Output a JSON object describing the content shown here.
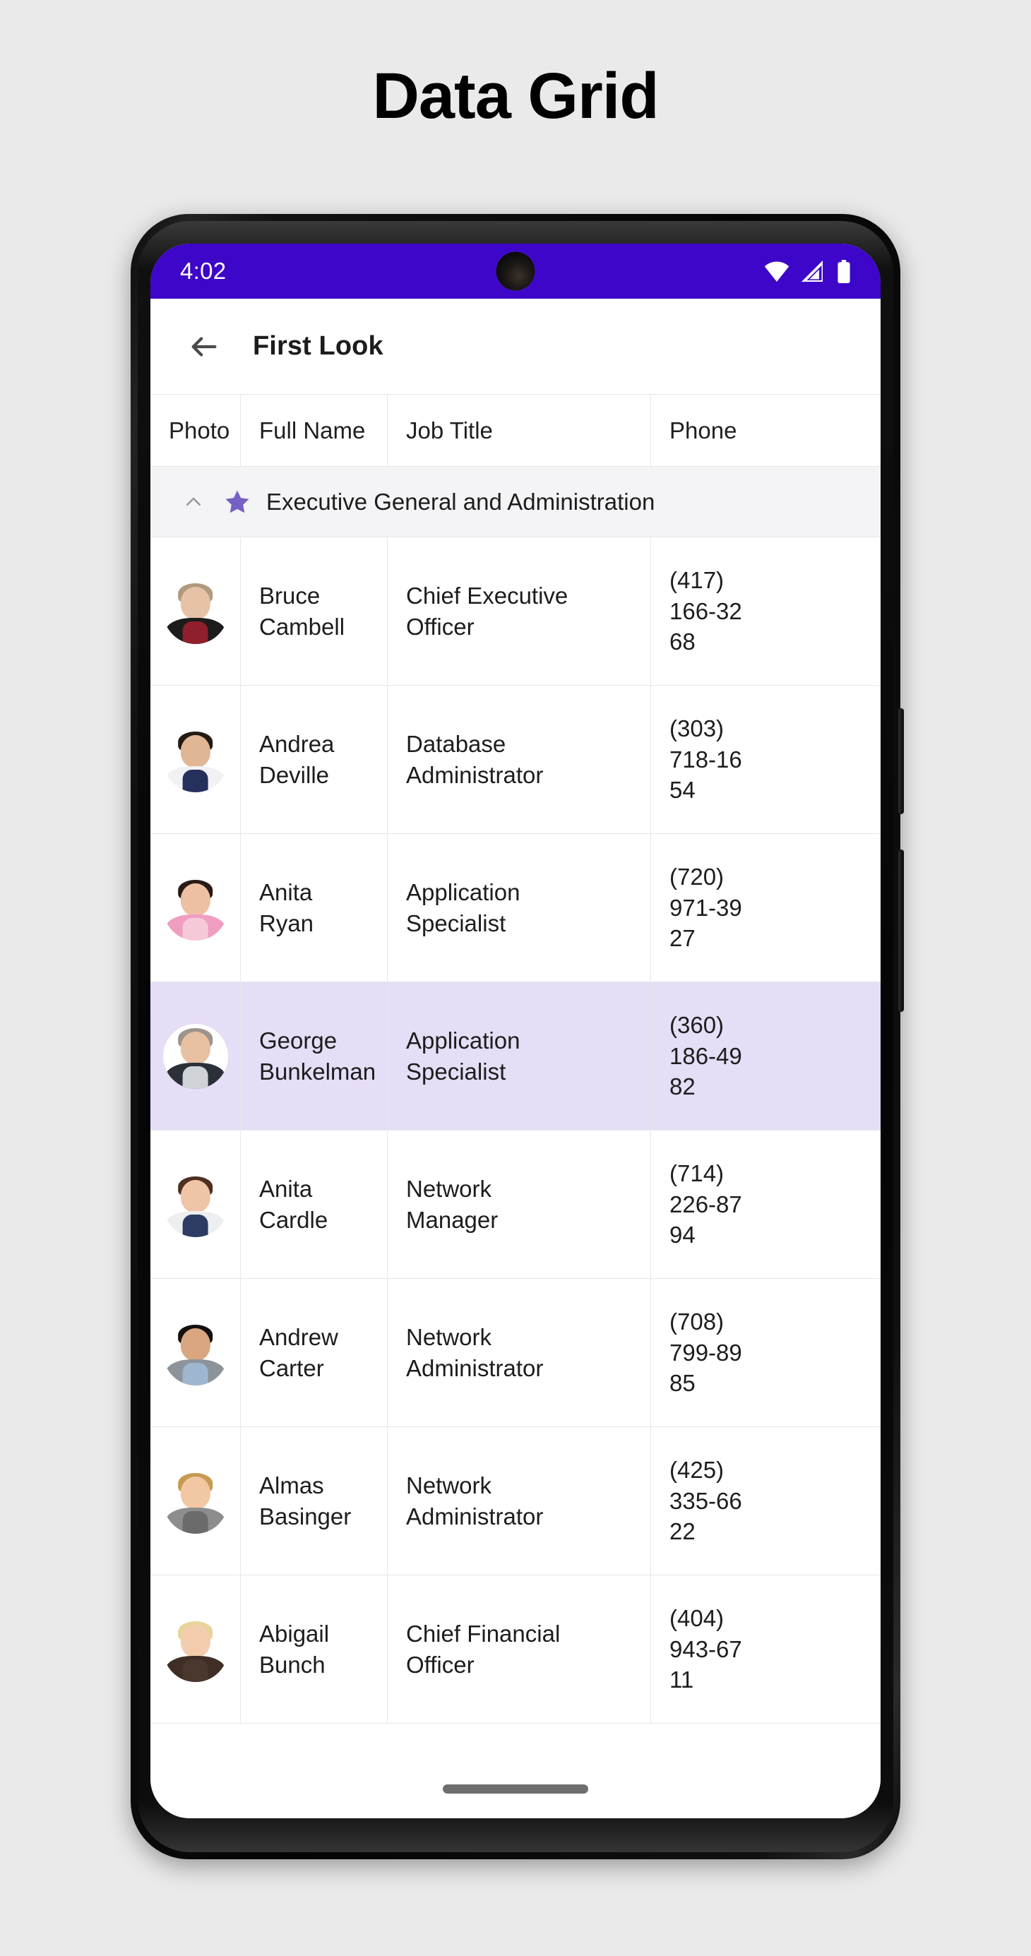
{
  "page": {
    "title": "Data Grid",
    "background_color": "#eaeaea"
  },
  "phone": {
    "status_bar": {
      "time": "4:02",
      "background_color": "#3d06c9",
      "icons": [
        "wifi-icon",
        "cellular-signal-icon",
        "battery-icon"
      ]
    },
    "app_bar": {
      "back_label": "back-arrow-icon",
      "title": "First Look"
    },
    "gesture_bar": "home-indicator"
  },
  "grid": {
    "columns": [
      {
        "key": "photo",
        "label": "Photo"
      },
      {
        "key": "name",
        "label": "Full Name"
      },
      {
        "key": "job",
        "label": "Job Title"
      },
      {
        "key": "phone",
        "label": "Phone"
      }
    ],
    "group": {
      "label": "Executive General and Administration",
      "expanded": true,
      "collapse_icon": "chevron-up-icon",
      "star_icon": "star-icon",
      "star_color": "#7560c4",
      "background_color": "#f4f3f5"
    },
    "selected_row_index": 3,
    "selected_row_color": "#e6ddf6",
    "rows": [
      {
        "name": "Bruce Cambell",
        "name_line1": "Bruce",
        "name_line2": "Cambell",
        "job": "Chief Executive Officer",
        "job_line1": "Chief Executive",
        "job_line2": "Officer",
        "phone": "(417) 166-3268",
        "phone_line1": "(417)",
        "phone_line2": "166-32",
        "phone_line3": "68",
        "avatar": "photo-bruce-cambell"
      },
      {
        "name": "Andrea Deville",
        "name_line1": "Andrea",
        "name_line2": "Deville",
        "job": "Database Administrator",
        "job_line1": "Database",
        "job_line2": "Administrator",
        "phone": "(303) 718-1654",
        "phone_line1": "(303)",
        "phone_line2": "718-16",
        "phone_line3": "54",
        "avatar": "photo-andrea-deville"
      },
      {
        "name": "Anita Ryan",
        "name_line1": "Anita Ryan",
        "name_line2": "",
        "job": "Application Specialist",
        "job_line1": "Application",
        "job_line2": "Specialist",
        "phone": "(720) 971-3927",
        "phone_line1": "(720)",
        "phone_line2": "971-39",
        "phone_line3": "27",
        "avatar": "photo-anita-ryan"
      },
      {
        "name": "George Bunkelman",
        "name_line1": "George",
        "name_line2": "Bunkelman",
        "job": "Application Specialist",
        "job_line1": "Application",
        "job_line2": "Specialist",
        "phone": "(360) 186-4982",
        "phone_line1": "(360)",
        "phone_line2": "186-49",
        "phone_line3": "82",
        "avatar": "photo-george-bunkelman"
      },
      {
        "name": "Anita Cardle",
        "name_line1": "Anita Cardle",
        "name_line2": "",
        "job": "Network Manager",
        "job_line1": "Network",
        "job_line2": "Manager",
        "phone": "(714) 226-8794",
        "phone_line1": "(714)",
        "phone_line2": "226-87",
        "phone_line3": "94",
        "avatar": "photo-anita-cardle"
      },
      {
        "name": "Andrew Carter",
        "name_line1": "Andrew",
        "name_line2": "Carter",
        "job": "Network Administrator",
        "job_line1": "Network",
        "job_line2": "Administrator",
        "phone": "(708) 799-8985",
        "phone_line1": "(708)",
        "phone_line2": "799-89",
        "phone_line3": "85",
        "avatar": "photo-andrew-carter"
      },
      {
        "name": "Almas Basinger",
        "name_line1": "Almas",
        "name_line2": "Basinger",
        "job": "Network Administrator",
        "job_line1": "Network",
        "job_line2": "Administrator",
        "phone": "(425) 335-6622",
        "phone_line1": "(425)",
        "phone_line2": "335-66",
        "phone_line3": "22",
        "avatar": "photo-almas-basinger"
      },
      {
        "name": "Abigail Bunch",
        "name_line1": "Abigail",
        "name_line2": "Bunch",
        "job": "Chief Financial Officer",
        "job_line1": "Chief Financial",
        "job_line2": "Officer",
        "phone": "(404) 943-6711",
        "phone_line1": "(404)",
        "phone_line2": "943-67",
        "phone_line3": "11",
        "avatar": "photo-abigail-bunch"
      }
    ]
  }
}
